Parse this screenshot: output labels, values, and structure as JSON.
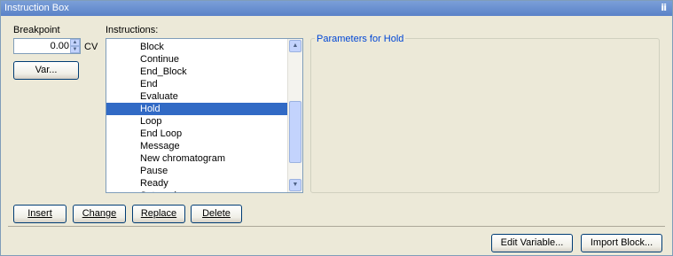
{
  "window": {
    "title": "Instruction Box",
    "pin_glyph": "Ũ"
  },
  "breakpoint": {
    "label": "Breakpoint",
    "value": "0.00",
    "unit": "CV",
    "var_button": "Var..."
  },
  "instructions": {
    "label": "Instructions:",
    "items": [
      "Block",
      "Continue",
      "End_Block",
      "End",
      "Evaluate",
      "Hold",
      "Loop",
      "End Loop",
      "Message",
      "New chromatogram",
      "Pause",
      "Ready",
      "Set mark"
    ],
    "selected": "Hold"
  },
  "parameters": {
    "title": "Parameters for Hold"
  },
  "actions": {
    "insert": "Insert",
    "change": "Change",
    "replace": "Replace",
    "delete": "Delete"
  },
  "footer": {
    "edit_variable": "Edit Variable...",
    "import_block": "Import Block..."
  }
}
